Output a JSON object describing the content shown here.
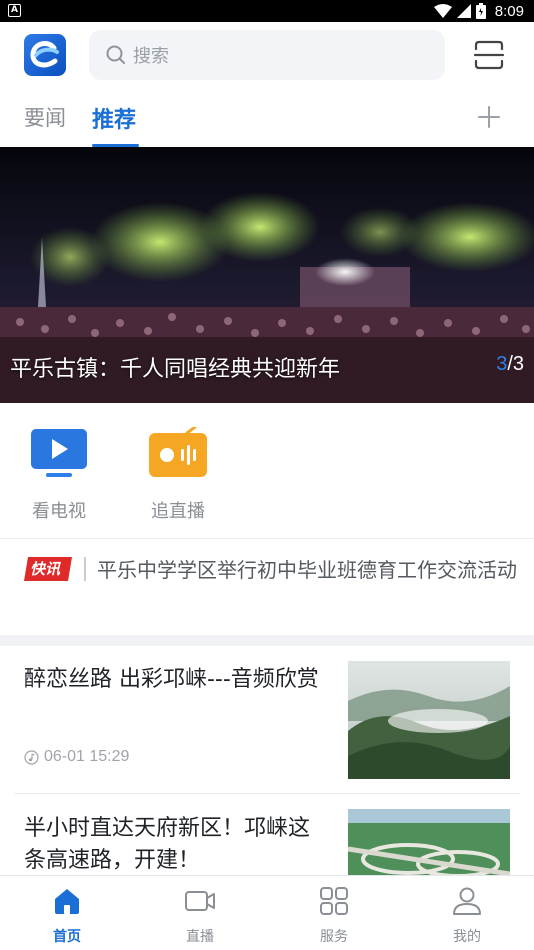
{
  "status_bar": {
    "time": "8:09",
    "app_indicator": "A",
    "icons": [
      "wifi-icon",
      "signal-icon",
      "battery-icon"
    ]
  },
  "header": {
    "logo": "app-logo-e",
    "search_placeholder": "搜索",
    "menu_icon": "scan-menu-icon"
  },
  "tabs": [
    {
      "label": "要闻",
      "active": false
    },
    {
      "label": "推荐",
      "active": true
    }
  ],
  "banner": {
    "caption": "平乐古镇：千人同唱经典共迎新年",
    "current_page": "3",
    "total_pages": "/3"
  },
  "quick_entries": [
    {
      "label": "看电视",
      "icon": "tv-play-icon",
      "color": "#2f7fe8"
    },
    {
      "label": "追直播",
      "icon": "live-radio-icon",
      "color": "#f5a623"
    }
  ],
  "flash": {
    "badge": "快讯",
    "text": "平乐中学学区举行初中毕业班德育工作交流活动"
  },
  "articles": [
    {
      "title": "醉恋丝路 出彩邛崃---音频欣赏",
      "meta_icon": "audio-icon",
      "time": "06-01 15:29"
    },
    {
      "title": "半小时直达天府新区！邛崃这条高速路，开建！"
    }
  ],
  "bottom_nav": [
    {
      "label": "首页",
      "icon": "home-icon",
      "active": true
    },
    {
      "label": "直播",
      "icon": "video-camera-icon",
      "active": false
    },
    {
      "label": "服务",
      "icon": "grid-icon",
      "active": false
    },
    {
      "label": "我的",
      "icon": "user-icon",
      "active": false
    }
  ],
  "colors": {
    "accent": "#1a6fd6",
    "flash_red": "#e02a2a",
    "live_orange": "#f5a623"
  }
}
